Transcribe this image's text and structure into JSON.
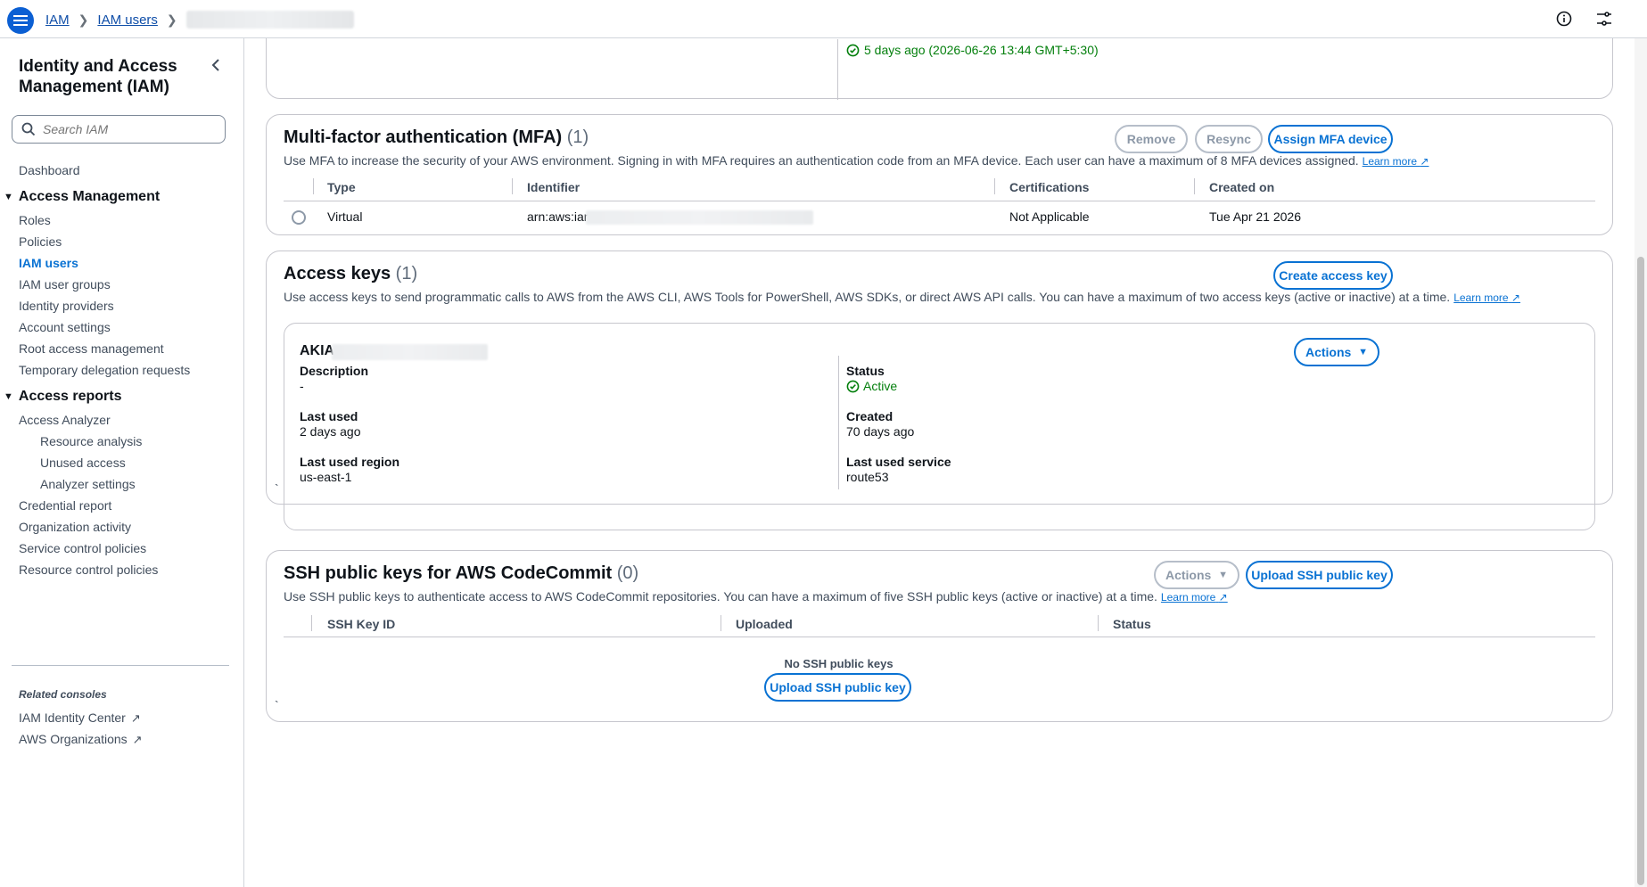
{
  "topbar": {
    "breadcrumbs": [
      "IAM",
      "IAM users"
    ],
    "icons": [
      "menu-icon",
      "info-icon",
      "settings-icon"
    ]
  },
  "sidebar": {
    "title": "Identity and Access Management (IAM)",
    "search_placeholder": "Search IAM",
    "dashboard": "Dashboard",
    "section_access_management": "Access Management",
    "access_management_items": [
      "Roles",
      "Policies",
      "IAM users",
      "IAM user groups",
      "Identity providers",
      "Account settings",
      "Root access management",
      "Temporary delegation requests"
    ],
    "section_access_reports": "Access reports",
    "access_analyzer": "Access Analyzer",
    "access_analyzer_items": [
      "Resource analysis",
      "Unused access",
      "Analyzer settings"
    ],
    "access_reports_items": [
      "Credential report",
      "Organization activity",
      "Service control policies",
      "Resource control policies"
    ],
    "related_label": "Related consoles",
    "related_items": [
      "IAM Identity Center",
      "AWS Organizations"
    ]
  },
  "top_partial": {
    "status_text": "5 days ago (2026-06-26 13:44 GMT+5:30)"
  },
  "mfa": {
    "title": "Multi-factor authentication (MFA)",
    "count": "(1)",
    "description": "Use MFA to increase the security of your AWS environment. Signing in with MFA requires an authentication code from an MFA device. Each user can have a maximum of 8 MFA devices assigned.",
    "learn_more": "Learn more",
    "buttons": {
      "remove": "Remove",
      "resync": "Resync",
      "assign": "Assign MFA device"
    },
    "columns": [
      "Type",
      "Identifier",
      "Certifications",
      "Created on"
    ],
    "rows": [
      {
        "type": "Virtual",
        "identifier": "arn:aws:iam:",
        "certifications": "Not Applicable",
        "created_on": "Tue Apr 21 2026"
      }
    ]
  },
  "access_keys": {
    "title": "Access keys",
    "count": "(1)",
    "description": "Use access keys to send programmatic calls to AWS from the AWS CLI, AWS Tools for PowerShell, AWS SDKs, or direct AWS API calls. You can have a maximum of two access keys (active or inactive) at a time.",
    "learn_more": "Learn more",
    "create_button": "Create access key",
    "key": {
      "id_prefix": "AKIA",
      "actions_button": "Actions",
      "description_label": "Description",
      "description_value": "-",
      "status_label": "Status",
      "status_value": "Active",
      "last_used_label": "Last used",
      "last_used_value": "2 days ago",
      "created_label": "Created",
      "created_value": "70 days ago",
      "last_used_region_label": "Last used region",
      "last_used_region_value": "us-east-1",
      "last_used_service_label": "Last used service",
      "last_used_service_value": "route53"
    }
  },
  "ssh": {
    "title": "SSH public keys for AWS CodeCommit",
    "count": "(0)",
    "description": "Use SSH public keys to authenticate access to AWS CodeCommit repositories. You can have a maximum of five SSH public keys (active or inactive) at a time.",
    "learn_more": "Learn more",
    "actions_button": "Actions",
    "upload_button": "Upload SSH public key",
    "columns": [
      "SSH Key ID",
      "Uploaded",
      "Status"
    ],
    "empty_text": "No SSH public keys",
    "empty_upload_button": "Upload SSH public key"
  },
  "stray_ticks": [
    "`",
    "`"
  ]
}
